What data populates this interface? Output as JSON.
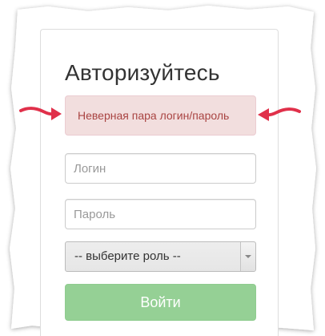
{
  "login_form": {
    "title": "Авторизуйтесь",
    "error_message": "Неверная пара логин/пароль",
    "login_placeholder": "Логин",
    "password_placeholder": "Пароль",
    "role_select_value": "-- выберите роль --",
    "submit_label": "Войти"
  },
  "colors": {
    "alert_background": "#f2dede",
    "alert_text": "#a94442",
    "submit_background": "#95d095",
    "annotation_arrow": "#e0304a"
  },
  "icons": {
    "select_arrow": "chevron-down-icon",
    "annotation": "curved-arrow-icon"
  }
}
